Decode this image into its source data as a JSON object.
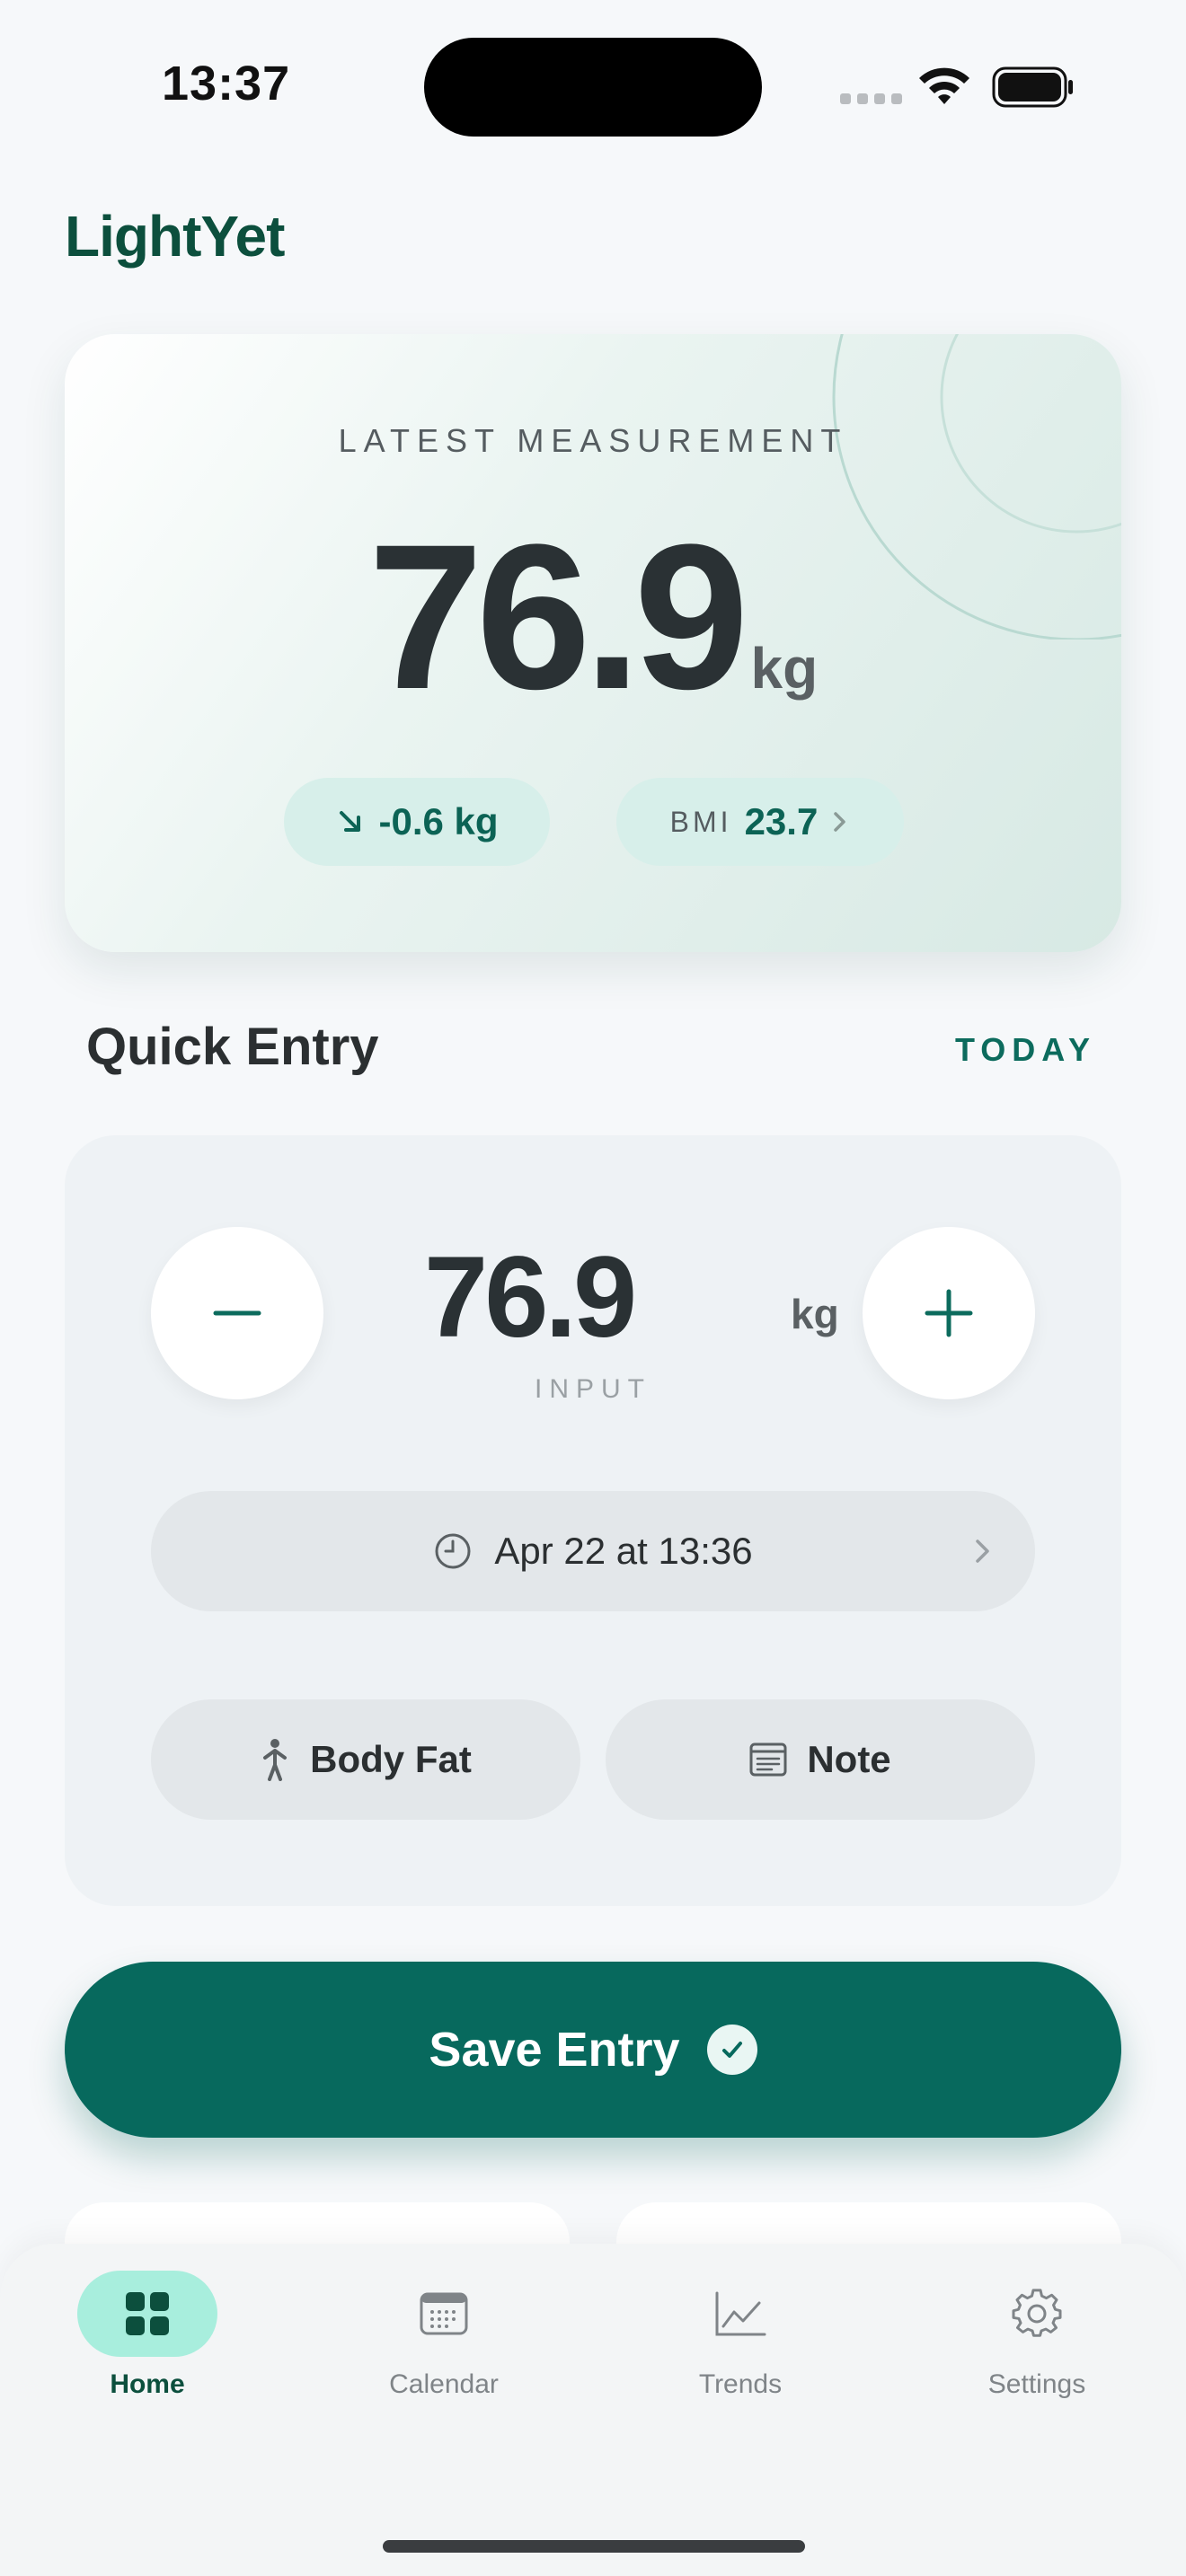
{
  "status_bar": {
    "time": "13:37",
    "icons": [
      "signal-dots-icon",
      "wifi-icon",
      "battery-icon"
    ]
  },
  "app": {
    "title": "LightYet"
  },
  "latest": {
    "label": "LATEST MEASUREMENT",
    "value": "76.9",
    "unit": "kg",
    "change": "-0.6 kg",
    "change_icon": "arrow-down-right-icon",
    "bmi_label": "BMI",
    "bmi_value": "23.7"
  },
  "quick_entry": {
    "title": "Quick Entry",
    "today_link": "TODAY",
    "value": "76.9",
    "unit": "kg",
    "input_label": "INPUT",
    "date_time": "Apr 22 at 13:36",
    "body_fat_label": "Body Fat",
    "note_label": "Note"
  },
  "save_button": {
    "label": "Save Entry"
  },
  "tabs": [
    {
      "label": "Home",
      "icon": "grid-icon",
      "active": true
    },
    {
      "label": "Calendar",
      "icon": "calendar-icon",
      "active": false
    },
    {
      "label": "Trends",
      "icon": "chart-icon",
      "active": false
    },
    {
      "label": "Settings",
      "icon": "gear-icon",
      "active": false
    }
  ],
  "colors": {
    "brand": "#0c4f3d",
    "accent": "#07695d",
    "pill_bg": "#d7efea",
    "active_tab_bg": "#a8eedd"
  }
}
